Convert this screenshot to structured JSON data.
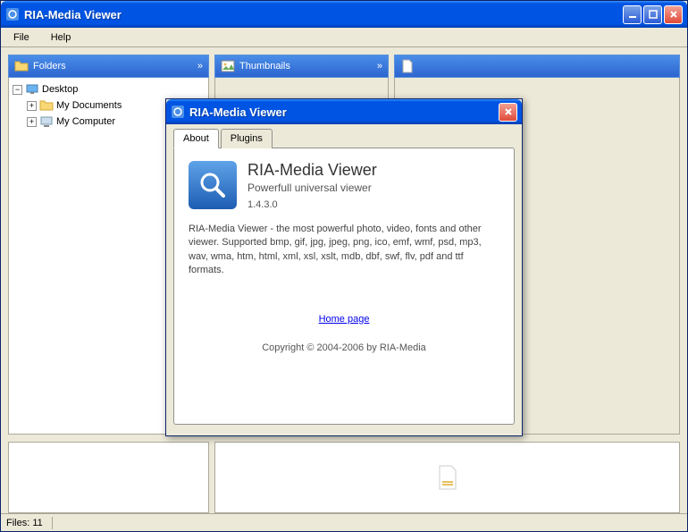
{
  "window": {
    "title": "RIA-Media Viewer"
  },
  "menu": {
    "file": "File",
    "help": "Help"
  },
  "panels": {
    "folders": "Folders",
    "thumbnails": "Thumbnails"
  },
  "tree": {
    "desktop": "Desktop",
    "my_documents": "My Documents",
    "my_computer": "My Computer"
  },
  "status": {
    "files": "Files: 11"
  },
  "dialog": {
    "title": "RIA-Media Viewer",
    "tabs": {
      "about": "About",
      "plugins": "Plugins"
    },
    "about": {
      "title": "RIA-Media Viewer",
      "subtitle": "Powerfull universal viewer",
      "version": "1.4.3.0",
      "description": "RIA-Media Viewer - the most powerful photo, video, fonts and other viewer. Supported bmp, gif, jpg, jpeg, png, ico, emf, wmf, psd, mp3, wav, wma, htm, html, xml, xsl, xslt, mdb, dbf, swf, flv, pdf and ttf formats.",
      "homepage": "Home page",
      "copyright": "Copyright © 2004-2006 by RIA-Media"
    }
  }
}
